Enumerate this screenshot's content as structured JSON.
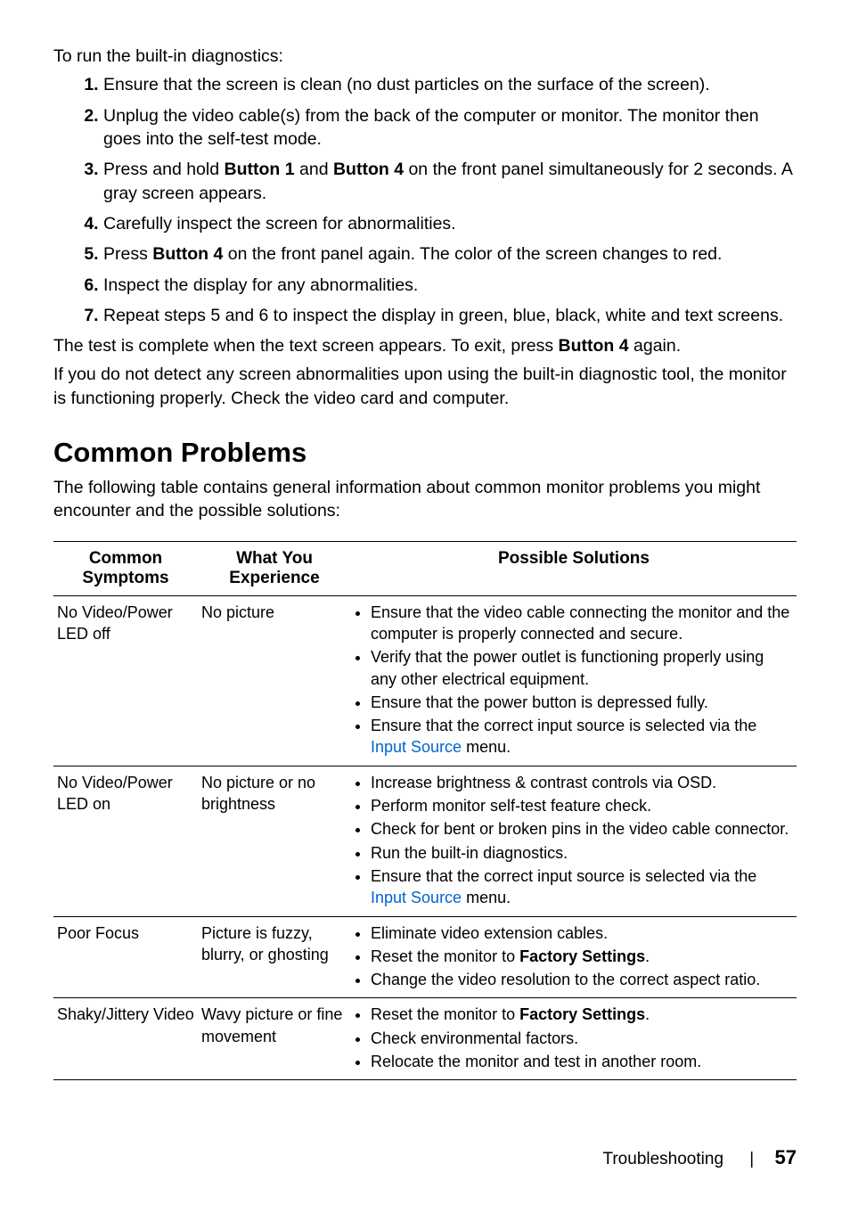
{
  "intro": "To run the built-in diagnostics:",
  "step1": "Ensure that the screen is clean (no dust particles on the surface of the screen).",
  "step2": "Unplug the video cable(s) from the back of the computer or monitor. The monitor then goes into the self-test mode.",
  "step3_a": "Press and hold ",
  "step3_b1": "Button 1",
  "step3_mid": " and ",
  "step3_b4": "Button 4",
  "step3_c": " on the front panel simultaneously for 2 seconds. A gray screen appears.",
  "step4": "Carefully inspect the screen for abnormalities.",
  "step5_a": "Press ",
  "step5_b": "Button 4",
  "step5_c": " on the front panel again. The color of the screen changes to red.",
  "step6": "Inspect the display for any abnormalities.",
  "step7": "Repeat steps 5 and 6 to inspect the display in green, blue, black, white and text screens.",
  "outro1_a": "The test is complete when the text screen appears. To exit, press ",
  "outro1_b": "Button 4",
  "outro1_c": " again.",
  "outro2": "If you do not detect any screen abnormalities upon using the built-in diagnostic tool, the monitor is functioning properly. Check the video card and computer.",
  "section_heading": "Common Problems",
  "section_intro": "The following table contains general information about common monitor problems you might encounter and the possible solutions:",
  "th1": "Common Symptoms",
  "th2": "What You Experience",
  "th3": "Possible Solutions",
  "r1c1": "No Video/Power LED off",
  "r1c2": "No picture",
  "r1s1": "Ensure that the video cable connecting the monitor and the computer is properly connected and secure.",
  "r1s2": "Verify that the power outlet is functioning properly using any other electrical equipment.",
  "r1s3": "Ensure that the power button is depressed fully.",
  "r1s4a": "Ensure that the correct input source is selected via the ",
  "r1s4link": "Input Source",
  "r1s4b": " menu.",
  "r2c1": "No Video/Power LED on",
  "r2c2": "No picture or no brightness",
  "r2s1": "Increase brightness & contrast controls via OSD.",
  "r2s2": "Perform monitor self-test feature check.",
  "r2s3": "Check for bent or broken pins in the video cable connector.",
  "r2s4": "Run the built-in diagnostics.",
  "r2s5a": "Ensure that the correct input source is selected via the ",
  "r2s5link": "Input Source",
  "r2s5b": " menu.",
  "r3c1": "Poor Focus",
  "r3c2": "Picture is fuzzy, blurry, or ghosting",
  "r3s1": "Eliminate video extension cables.",
  "r3s2a": "Reset the monitor to ",
  "r3s2b": "Factory Settings",
  "r3s2c": ".",
  "r3s3": "Change the video resolution to the correct aspect ratio.",
  "r4c1": "Shaky/Jittery Video",
  "r4c2": "Wavy picture or fine movement",
  "r4s1a": "Reset the monitor to ",
  "r4s1b": "Factory Settings",
  "r4s1c": ".",
  "r4s2": "Check environmental factors.",
  "r4s3": "Relocate the monitor and test in another room.",
  "footer_section": "Troubleshooting",
  "footer_page": "57"
}
